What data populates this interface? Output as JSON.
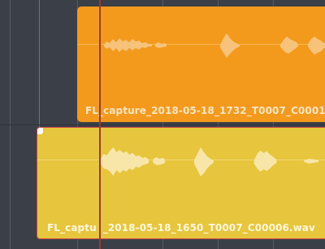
{
  "timeline": {
    "clips": [
      {
        "name": "FL_capture_2018-05-18_1732_T0007_C0001",
        "color": "#f39a1d",
        "selected": false
      },
      {
        "name": "FL_captu",
        "name_rest": "_2018-05-18_1650_T0007_C00006.wav",
        "color": "#e7c53c",
        "selected": true
      }
    ],
    "playhead_color": "#9a3b2d"
  }
}
